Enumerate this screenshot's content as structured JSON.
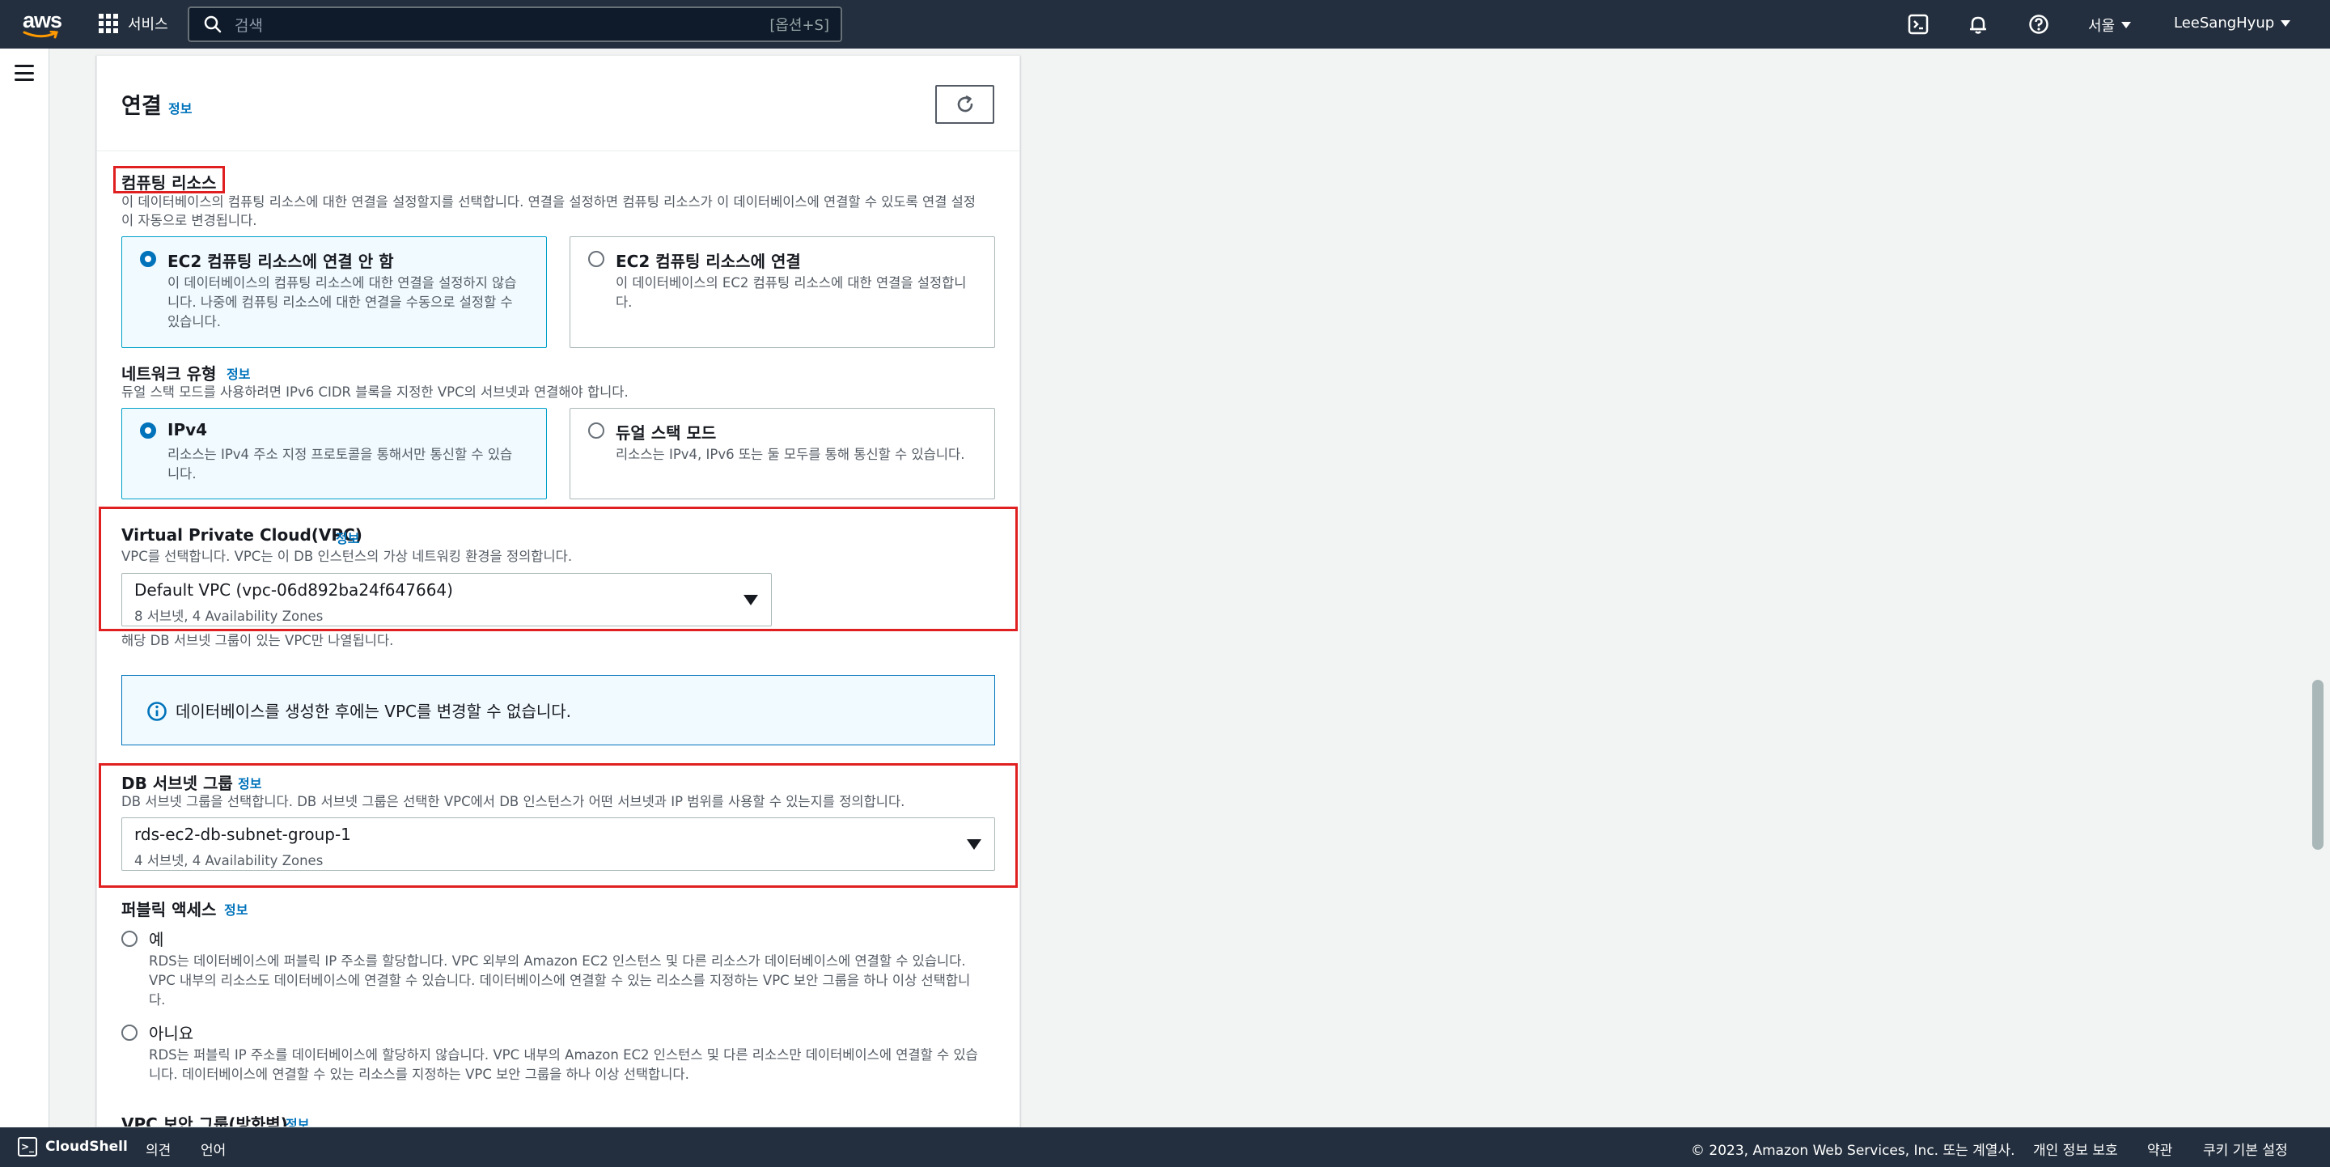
{
  "topnav": {
    "logo_text": "aws",
    "services_label": "서비스",
    "search_placeholder": "검색",
    "search_shortcut": "[옵션+S]",
    "region": "서울",
    "user": "LeeSangHyup"
  },
  "panel": {
    "title": "연결",
    "info": "정보"
  },
  "compute": {
    "label": "컴퓨팅 리소스",
    "desc_line1": "이 데이터베이스의 컴퓨팅 리소스에 대한 연결을 설정할지를 선택합니다. 연결을 설정하면 컴퓨팅 리소스가 이 데이터베이스에 연결할 수 있도록 연결 설정",
    "desc_line2": "이 자동으로 변경됩니다.",
    "options": [
      {
        "title": "EC2 컴퓨팅 리소스에 연결 안 함",
        "desc": "이 데이터베이스의 컴퓨팅 리소스에 대한 연결을 설정하지 않습니다. 나중에 컴퓨팅 리소스에 대한 연결을 수동으로 설정할 수 있습니다.",
        "selected": true
      },
      {
        "title": "EC2 컴퓨팅 리소스에 연결",
        "desc": "이 데이터베이스의 EC2 컴퓨팅 리소스에 대한 연결을 설정합니다.",
        "selected": false
      }
    ]
  },
  "network": {
    "label": "네트워크 유형",
    "info": "정보",
    "desc": "듀얼 스택 모드를 사용하려면 IPv6 CIDR 블록을 지정한 VPC의 서브넷과 연결해야 합니다.",
    "options": [
      {
        "title": "IPv4",
        "desc": "리소스는 IPv4 주소 지정 프로토콜을 통해서만 통신할 수 있습니다.",
        "selected": true
      },
      {
        "title": "듀얼 스택 모드",
        "desc": "리소스는 IPv4, IPv6 또는 둘 모두를 통해 통신할 수 있습니다.",
        "selected": false
      }
    ]
  },
  "vpc": {
    "label": "Virtual Private Cloud(VPC)",
    "info": "정보",
    "desc": "VPC를 선택합니다. VPC는 이 DB 인스턴스의 가상 네트워킹 환경을 정의합니다.",
    "value": "Default VPC (vpc-06d892ba24f647664)",
    "sub": "8 서브넷, 4 Availability Zones",
    "hint": "해당 DB 서브넷 그룹이 있는 VPC만 나열됩니다."
  },
  "alert": {
    "text": "데이터베이스를 생성한 후에는 VPC를 변경할 수 없습니다."
  },
  "subnet": {
    "label": "DB 서브넷 그룹",
    "info": "정보",
    "desc": "DB 서브넷 그룹을 선택합니다. DB 서브넷 그룹은 선택한 VPC에서 DB 인스턴스가 어떤 서브넷과 IP 범위를 사용할 수 있는지를 정의합니다.",
    "value": "rds-ec2-db-subnet-group-1",
    "sub": "4 서브넷, 4 Availability Zones"
  },
  "public": {
    "label": "퍼블릭 액세스",
    "info": "정보",
    "yes_label": "예",
    "yes_desc_1": "RDS는 데이터베이스에 퍼블릭 IP 주소를 할당합니다. VPC 외부의 Amazon EC2 인스턴스 및 다른 리소스가 데이터베이스에 연결할 수 있습니다.",
    "yes_desc_2": "VPC 내부의 리소스도 데이터베이스에 연결할 수 있습니다. 데이터베이스에 연결할 수 있는 리소스를 지정하는 VPC 보안 그룹을 하나 이상 선택합니",
    "yes_desc_3": "다.",
    "no_label": "아니요",
    "no_desc_1": "RDS는 퍼블릭 IP 주소를 데이터베이스에 할당하지 않습니다. VPC 내부의 Amazon EC2 인스턴스 및 다른 리소스만 데이터베이스에 연결할 수 있습",
    "no_desc_2": "니다. 데이터베이스에 연결할 수 있는 리소스를 지정하는 VPC 보안 그룹을 하나 이상 선택합니다."
  },
  "security": {
    "label": "VPC 보안 그룹(방화벽)",
    "info": "정보"
  },
  "footer": {
    "cloudshell": "CloudShell",
    "feedback": "의견",
    "language": "언어",
    "copyright": "© 2023, Amazon Web Services, Inc. 또는 계열사.",
    "privacy": "개인 정보 보호",
    "terms": "약관",
    "cookies": "쿠키 기본 설정"
  }
}
